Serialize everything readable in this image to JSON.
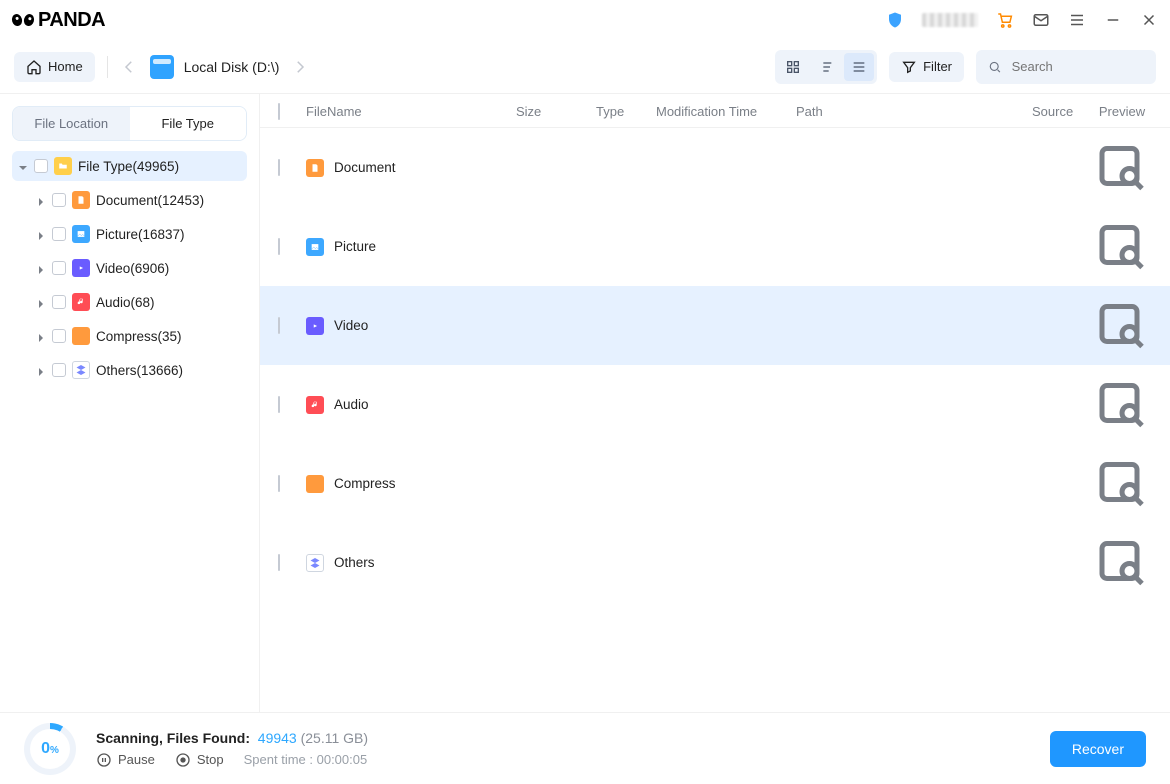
{
  "app": {
    "brand": "PANDA"
  },
  "titlebar": {
    "icons": [
      "shield",
      "cart",
      "envelope",
      "menu",
      "minimize",
      "close"
    ]
  },
  "toolbar": {
    "home_label": "Home",
    "location_label": "Local Disk (D:\\)",
    "filter_label": "Filter",
    "search_placeholder": "Search"
  },
  "sidebar": {
    "tabs": {
      "file_location": "File Location",
      "file_type": "File Type"
    },
    "root_label": "File Type(49965)",
    "items": [
      {
        "key": "document",
        "label": "Document(12453)",
        "icon": "doc"
      },
      {
        "key": "picture",
        "label": "Picture(16837)",
        "icon": "pic"
      },
      {
        "key": "video",
        "label": "Video(6906)",
        "icon": "vid"
      },
      {
        "key": "audio",
        "label": "Audio(68)",
        "icon": "aud"
      },
      {
        "key": "compress",
        "label": "Compress(35)",
        "icon": "cmp"
      },
      {
        "key": "others",
        "label": "Others(13666)",
        "icon": "oth"
      }
    ]
  },
  "columns": {
    "filename": "FileName",
    "size": "Size",
    "type": "Type",
    "modification": "Modification Time",
    "path": "Path",
    "source": "Source",
    "preview": "Preview"
  },
  "rows": [
    {
      "key": "document",
      "label": "Document",
      "icon": "doc",
      "selected": false
    },
    {
      "key": "picture",
      "label": "Picture",
      "icon": "pic",
      "selected": false
    },
    {
      "key": "video",
      "label": "Video",
      "icon": "vid",
      "selected": true
    },
    {
      "key": "audio",
      "label": "Audio",
      "icon": "aud",
      "selected": false
    },
    {
      "key": "compress",
      "label": "Compress",
      "icon": "cmp",
      "selected": false
    },
    {
      "key": "others",
      "label": "Others",
      "icon": "oth",
      "selected": false
    }
  ],
  "footer": {
    "progress_pct": "0",
    "progress_unit": "%",
    "status_prefix": "Scanning, Files Found:",
    "found_count": "49943",
    "found_size": "(25.11 GB)",
    "pause_label": "Pause",
    "stop_label": "Stop",
    "spent_label": "Spent time : 00:00:05",
    "recover_label": "Recover"
  }
}
